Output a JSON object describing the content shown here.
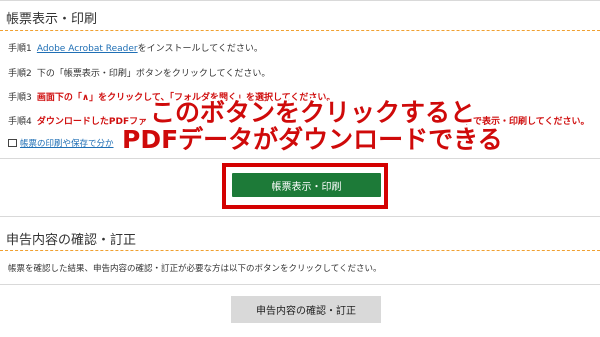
{
  "print_section": {
    "title": "帳票表示・印刷",
    "steps": [
      {
        "num": "手順1",
        "link": "Adobe Acrobat Reader",
        "text": "をインストールしてください。"
      },
      {
        "num": "手順2",
        "text": "下の「帳票表示・印刷」ボタンをクリックしてください。"
      },
      {
        "num": "手順3",
        "text": "画面下の「∧」をクリックして、「フォルダを開く」を選択してください。"
      },
      {
        "num": "手順4",
        "text": "ダウンロードしたPDFファ",
        "text_end": "ァで表示・印刷してください。"
      }
    ],
    "help_link": "帳票の印刷や保存で分か",
    "button_label": "帳票表示・印刷"
  },
  "overlay": {
    "line1": "このボタンをクリックすると",
    "line2": "PDFデータがダウンロードできる"
  },
  "confirm_section": {
    "title": "申告内容の確認・訂正",
    "description": "帳票を確認した結果、申告内容の確認・訂正が必要な方は以下のボタンをクリックしてください。",
    "button_label": "申告内容の確認・訂正"
  },
  "colors": {
    "accent_green": "#1d7a38",
    "highlight_red": "#d40000",
    "divider_orange": "#f0a030",
    "link_blue": "#1f6fb5"
  }
}
